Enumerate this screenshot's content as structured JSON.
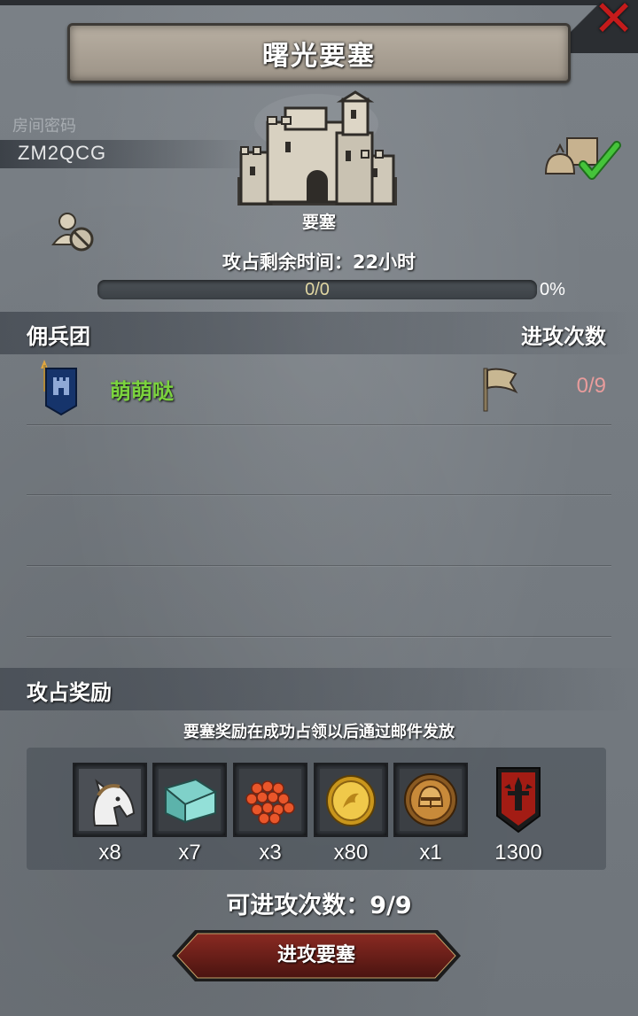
{
  "title": "曙光要塞",
  "room": {
    "label": "房间密码",
    "code": "ZM2QCG"
  },
  "fortress": {
    "label": "要塞"
  },
  "remaining_time": "攻占剩余时间：22小时",
  "progress": {
    "value_text": "0/0",
    "percent_text": "0%",
    "fraction": 0
  },
  "mercenary": {
    "header": "佣兵团",
    "attacks_header": "进攻次数",
    "guild_name": "萌萌哒",
    "attack_count": "0/9"
  },
  "rewards": {
    "header": "攻占奖励",
    "note": "要塞奖励在成功占领以后通过邮件发放",
    "items": [
      {
        "icon": "horse-icon",
        "qty": "x8"
      },
      {
        "icon": "cloth-roll-icon",
        "qty": "x7"
      },
      {
        "icon": "berries-icon",
        "qty": "x3"
      },
      {
        "icon": "gold-coin-icon",
        "qty": "x80"
      },
      {
        "icon": "helmet-coin-icon",
        "qty": "x1"
      },
      {
        "icon": "guild-banner-icon",
        "qty": "1300"
      }
    ]
  },
  "attacks_available": "可进攻次数：9/9",
  "attack_button": "进攻要塞",
  "colors": {
    "guild_name": "#7bd33e",
    "attack_count": "#e89c9c",
    "close": "#c41b1b"
  }
}
